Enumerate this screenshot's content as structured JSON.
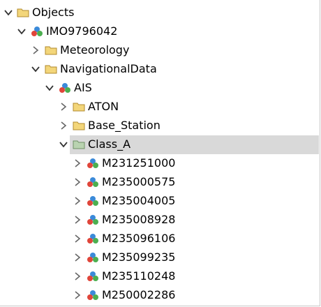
{
  "tree": {
    "root": {
      "label": "Objects",
      "expanded": true,
      "icon": "folder-icon"
    },
    "vessel": {
      "label": "IMO9796042",
      "expanded": true,
      "icon": "object-icon"
    },
    "meteorology": {
      "label": "Meteorology",
      "expanded": false,
      "icon": "folder-icon"
    },
    "navigational": {
      "label": "NavigationalData",
      "expanded": true,
      "icon": "folder-icon"
    },
    "ais": {
      "label": "AIS",
      "expanded": true,
      "icon": "object-icon"
    },
    "aton": {
      "label": "ATON",
      "expanded": false,
      "icon": "folder-icon"
    },
    "base_station": {
      "label": "Base_Station",
      "expanded": false,
      "icon": "folder-icon"
    },
    "class_a": {
      "label": "Class_A",
      "expanded": true,
      "selected": true,
      "icon": "folder-icon"
    },
    "ships": [
      {
        "label": "M231251000"
      },
      {
        "label": "M235000575"
      },
      {
        "label": "M235004005"
      },
      {
        "label": "M235008928"
      },
      {
        "label": "M235096106"
      },
      {
        "label": "M235099235"
      },
      {
        "label": "M235110248"
      },
      {
        "label": "M250002286"
      }
    ]
  },
  "colors": {
    "selection": "#d9d9d9",
    "folder": "#f3d67a",
    "folder_selected": "#b9d3b0",
    "object_red": "#e0453a",
    "object_green": "#4caf50",
    "object_blue": "#3b8ad9"
  }
}
